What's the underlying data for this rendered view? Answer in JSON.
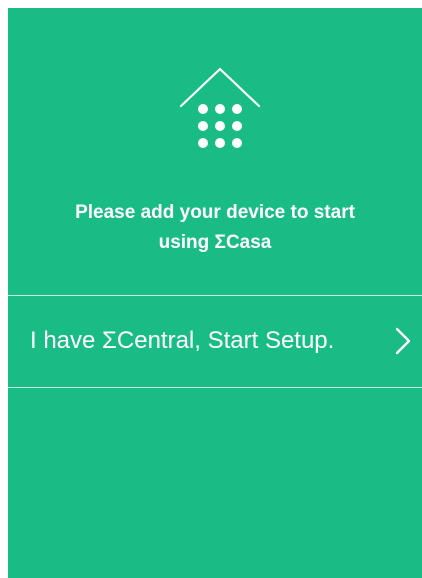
{
  "app": {
    "logo_icon": "house-keypad-icon",
    "background_color": "#1abc86",
    "text_color": "#ffffff"
  },
  "headline": {
    "line1": "Please add your device to start",
    "line2": "using ΣCasa"
  },
  "setup_row": {
    "label": "I have ΣCentral, Start Setup.",
    "icon": "chevron-right-icon"
  }
}
